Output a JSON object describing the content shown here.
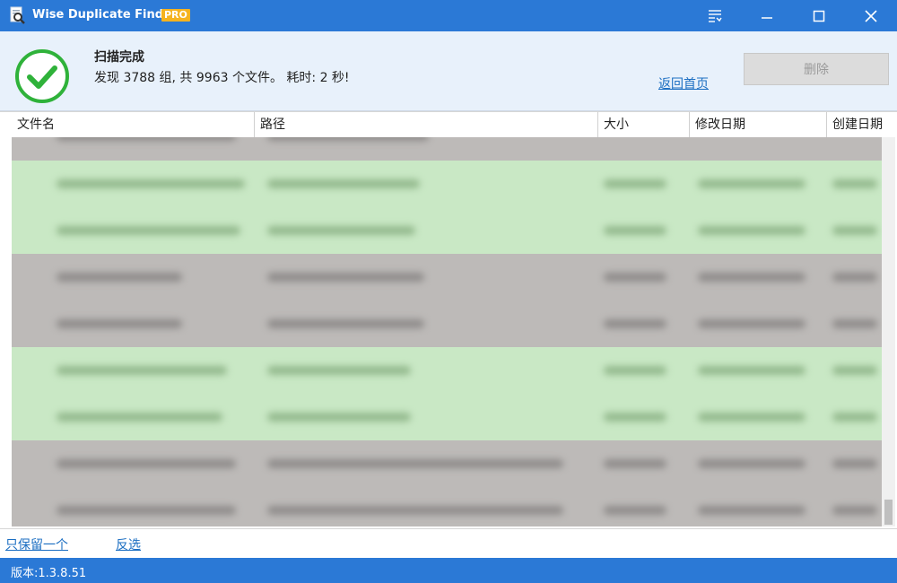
{
  "titlebar": {
    "app_name": "Wise Duplicate Finder",
    "badge": "PRO",
    "icons": [
      "app-icon",
      "menu-icon",
      "minimize-icon",
      "maximize-icon",
      "close-icon"
    ]
  },
  "header": {
    "status_title": "扫描完成",
    "summary": "发现 3788 组, 共 9963 个文件。 耗时: 2 秒!",
    "back_link": "返回首页",
    "delete_button": "删除",
    "status_icon": "check-circle-icon",
    "accent_color": "#2fb23a"
  },
  "table": {
    "columns": [
      "文件名",
      "路径",
      "大小",
      "修改日期",
      "创建日期"
    ],
    "row_colors": [
      "#c9e8c5",
      "#bdbab8"
    ]
  },
  "footer": {
    "keep_one_link": "只保留一个",
    "invert_link": "反选"
  },
  "statusbar": {
    "version": "版本:1.3.8.51"
  },
  "colors": {
    "brand_blue": "#2b79d6",
    "link_blue": "#1b6ec2"
  }
}
